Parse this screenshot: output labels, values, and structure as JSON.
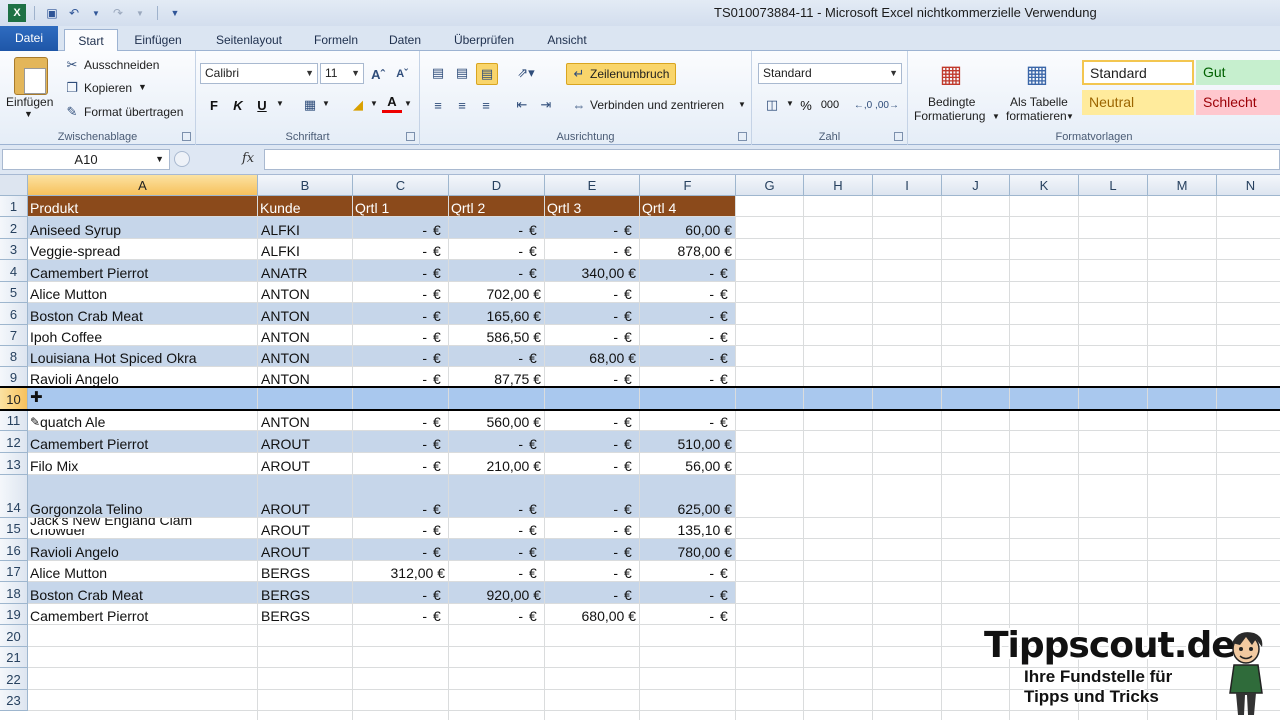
{
  "window": {
    "title": "TS010073884-11  -  Microsoft Excel nichtkommerzielle Verwendung"
  },
  "tabs": [
    "Datei",
    "Start",
    "Einfügen",
    "Seitenlayout",
    "Formeln",
    "Daten",
    "Überprüfen",
    "Ansicht"
  ],
  "ribbon": {
    "clipboard": {
      "paste": "Einfügen",
      "cut": "Ausschneiden",
      "copy": "Kopieren",
      "format_painter": "Format übertragen",
      "label": "Zwischenablage"
    },
    "font": {
      "name": "Calibri",
      "size": "11",
      "bold": "F",
      "italic": "K",
      "underline": "U",
      "color_letter": "A",
      "label": "Schriftart"
    },
    "alignment": {
      "wrap": "Zeilenumbruch",
      "merge": "Verbinden und zentrieren",
      "label": "Ausrichtung"
    },
    "number": {
      "format": "Standard",
      "percent": "%",
      "thousands": "000",
      "label": "Zahl"
    },
    "styles": {
      "cond_format": [
        "Bedingte",
        "Formatierung"
      ],
      "as_table": [
        "Als Tabelle",
        "formatieren"
      ],
      "standard": "Standard",
      "gut": "Gut",
      "neutral": "Neutral",
      "schlecht": "Schlecht",
      "label": "Formatvorlagen"
    }
  },
  "formula_bar": {
    "cell_ref": "A10",
    "fx": "fx",
    "content": ""
  },
  "columns": [
    "A",
    "B",
    "C",
    "D",
    "E",
    "F",
    "G",
    "H",
    "I",
    "J",
    "K",
    "L",
    "M",
    "N"
  ],
  "rows": [
    "1",
    "2",
    "3",
    "4",
    "5",
    "6",
    "7",
    "8",
    "9",
    "10",
    "11",
    "12",
    "13",
    "14",
    "15",
    "16",
    "17",
    "18",
    "19",
    "20",
    "21",
    "22",
    "23"
  ],
  "table": {
    "headers": [
      "Produkt",
      "Kunde",
      "Qrtl 1",
      "Qrtl 2",
      "Qrtl 3",
      "Qrtl 4"
    ],
    "records": [
      {
        "row": 2,
        "produkt": "Aniseed Syrup",
        "kunde": "ALFKI",
        "q": [
          "-",
          "-",
          "-",
          "60,00"
        ]
      },
      {
        "row": 3,
        "produkt": "Veggie-spread",
        "kunde": "ALFKI",
        "q": [
          "-",
          "-",
          "-",
          "878,00"
        ]
      },
      {
        "row": 4,
        "produkt": "Camembert Pierrot",
        "kunde": "ANATR",
        "q": [
          "-",
          "-",
          "340,00",
          "-"
        ]
      },
      {
        "row": 5,
        "produkt": "Alice Mutton",
        "kunde": "ANTON",
        "q": [
          "-",
          "702,00",
          "-",
          "-"
        ]
      },
      {
        "row": 6,
        "produkt": "Boston Crab Meat",
        "kunde": "ANTON",
        "q": [
          "-",
          "165,60",
          "-",
          "-"
        ]
      },
      {
        "row": 7,
        "produkt": "Ipoh Coffee",
        "kunde": "ANTON",
        "q": [
          "-",
          "586,50",
          "-",
          "-"
        ]
      },
      {
        "row": 8,
        "produkt": "Louisiana Hot Spiced Okra",
        "kunde": "ANTON",
        "q": [
          "-",
          "-",
          "68,00",
          "-"
        ]
      },
      {
        "row": 9,
        "produkt": "Ravioli Angelo",
        "kunde": "ANTON",
        "q": [
          "-",
          "87,75",
          "-",
          "-"
        ]
      },
      {
        "row": 11,
        "produkt": "quatch Ale",
        "kunde": "ANTON",
        "q": [
          "-",
          "560,00",
          "-",
          "-"
        ]
      },
      {
        "row": 12,
        "produkt": "Camembert Pierrot",
        "kunde": "AROUT",
        "q": [
          "-",
          "-",
          "-",
          "510,00"
        ]
      },
      {
        "row": 13,
        "produkt": "Filo Mix",
        "kunde": "AROUT",
        "q": [
          "-",
          "210,00",
          "-",
          "56,00"
        ]
      },
      {
        "row": 14,
        "produkt": "Gorgonzola Telino",
        "kunde": "AROUT",
        "q": [
          "-",
          "-",
          "-",
          "625,00"
        ]
      },
      {
        "row": 15,
        "produkt": "Jack's New England Clam",
        "produkt2": "Chowder",
        "kunde": "AROUT",
        "q": [
          "-",
          "-",
          "-",
          "135,10"
        ]
      },
      {
        "row": 16,
        "produkt": "Ravioli Angelo",
        "kunde": "AROUT",
        "q": [
          "-",
          "-",
          "-",
          "780,00"
        ]
      },
      {
        "row": 17,
        "produkt": "Alice Mutton",
        "kunde": "BERGS",
        "q": [
          "312,00",
          "-",
          "-",
          "-"
        ]
      },
      {
        "row": 18,
        "produkt": "Boston Crab Meat",
        "kunde": "BERGS",
        "q": [
          "-",
          "920,00",
          "-",
          "-"
        ]
      },
      {
        "row": 19,
        "produkt": "Camembert Pierrot",
        "kunde": "BERGS",
        "q": [
          "-",
          "-",
          "680,00",
          "-"
        ]
      }
    ],
    "currency": "€"
  },
  "selection": {
    "cell": "A10",
    "row": "10",
    "column": "A"
  },
  "watermark": {
    "title": "Tippscout.de",
    "line1": "Ihre Fundstelle für",
    "line2": "Tipps und Tricks"
  },
  "colors": {
    "header_band": "#8b4a1b",
    "blue_band": "#c6d6ea",
    "selected_row": "#a9c8ee",
    "tab_file": "#2f6cc0"
  }
}
